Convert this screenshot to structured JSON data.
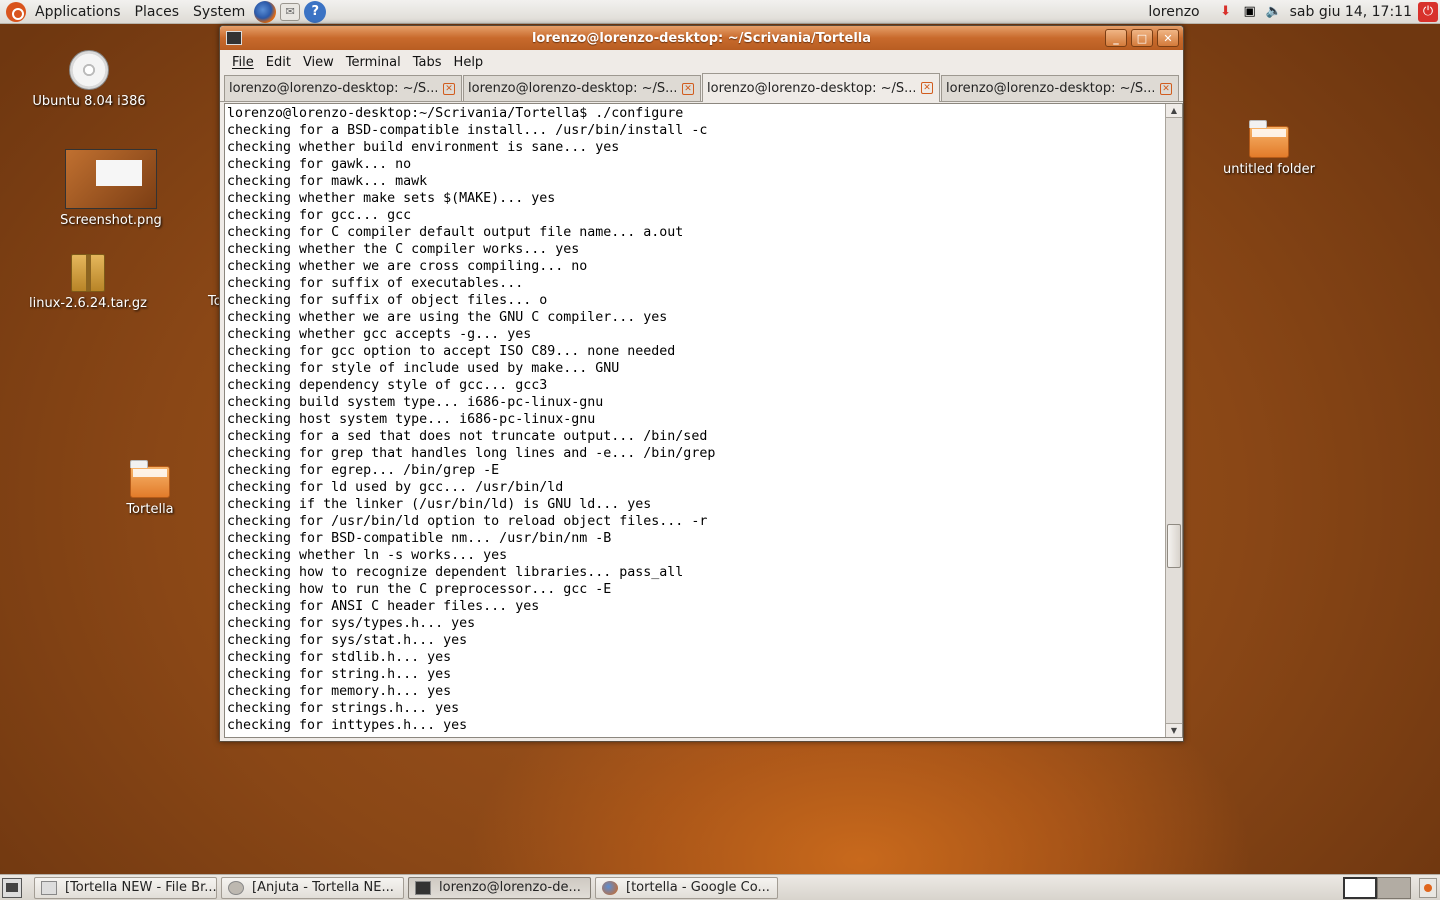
{
  "top_panel": {
    "menus": [
      "Applications",
      "Places",
      "System"
    ],
    "user": "lorenzo",
    "clock": "sab giu 14, 17:11"
  },
  "desktop_icons": {
    "cd": "Ubuntu 8.04 i386",
    "screenshot": "Screenshot.png",
    "archive": "linux-2.6.24.tar.gz",
    "folder_tortella": "Tortella",
    "folder_untitled": "untitled folder",
    "partial_hidden": "To"
  },
  "window": {
    "title": "lorenzo@lorenzo-desktop: ~/Scrivania/Tortella",
    "menus": [
      "File",
      "Edit",
      "View",
      "Terminal",
      "Tabs",
      "Help"
    ],
    "tabs": [
      {
        "label": "lorenzo@lorenzo-desktop: ~/S..."
      },
      {
        "label": "lorenzo@lorenzo-desktop: ~/S..."
      },
      {
        "label": "lorenzo@lorenzo-desktop: ~/S..."
      },
      {
        "label": "lorenzo@lorenzo-desktop: ~/S..."
      }
    ],
    "active_tab": 2,
    "terminal_lines": [
      "lorenzo@lorenzo-desktop:~/Scrivania/Tortella$ ./configure",
      "checking for a BSD-compatible install... /usr/bin/install -c",
      "checking whether build environment is sane... yes",
      "checking for gawk... no",
      "checking for mawk... mawk",
      "checking whether make sets $(MAKE)... yes",
      "checking for gcc... gcc",
      "checking for C compiler default output file name... a.out",
      "checking whether the C compiler works... yes",
      "checking whether we are cross compiling... no",
      "checking for suffix of executables...",
      "checking for suffix of object files... o",
      "checking whether we are using the GNU C compiler... yes",
      "checking whether gcc accepts -g... yes",
      "checking for gcc option to accept ISO C89... none needed",
      "checking for style of include used by make... GNU",
      "checking dependency style of gcc... gcc3",
      "checking build system type... i686-pc-linux-gnu",
      "checking host system type... i686-pc-linux-gnu",
      "checking for a sed that does not truncate output... /bin/sed",
      "checking for grep that handles long lines and -e... /bin/grep",
      "checking for egrep... /bin/grep -E",
      "checking for ld used by gcc... /usr/bin/ld",
      "checking if the linker (/usr/bin/ld) is GNU ld... yes",
      "checking for /usr/bin/ld option to reload object files... -r",
      "checking for BSD-compatible nm... /usr/bin/nm -B",
      "checking whether ln -s works... yes",
      "checking how to recognize dependent libraries... pass_all",
      "checking how to run the C preprocessor... gcc -E",
      "checking for ANSI C header files... yes",
      "checking for sys/types.h... yes",
      "checking for sys/stat.h... yes",
      "checking for stdlib.h... yes",
      "checking for string.h... yes",
      "checking for memory.h... yes",
      "checking for strings.h... yes",
      "checking for inttypes.h... yes"
    ]
  },
  "taskbar": {
    "items": [
      {
        "label": "[Tortella NEW - File Br...",
        "icon": "file-browser-icon"
      },
      {
        "label": "[Anjuta - Tortella NE...",
        "icon": "anjuta-icon"
      },
      {
        "label": "lorenzo@lorenzo-de...",
        "icon": "terminal-icon"
      },
      {
        "label": "[tortella - Google Co...",
        "icon": "firefox-icon"
      }
    ]
  },
  "colors": {
    "accent": "#d9541d",
    "titlebar": "#c86a2c",
    "desktop": "#8a4716"
  }
}
